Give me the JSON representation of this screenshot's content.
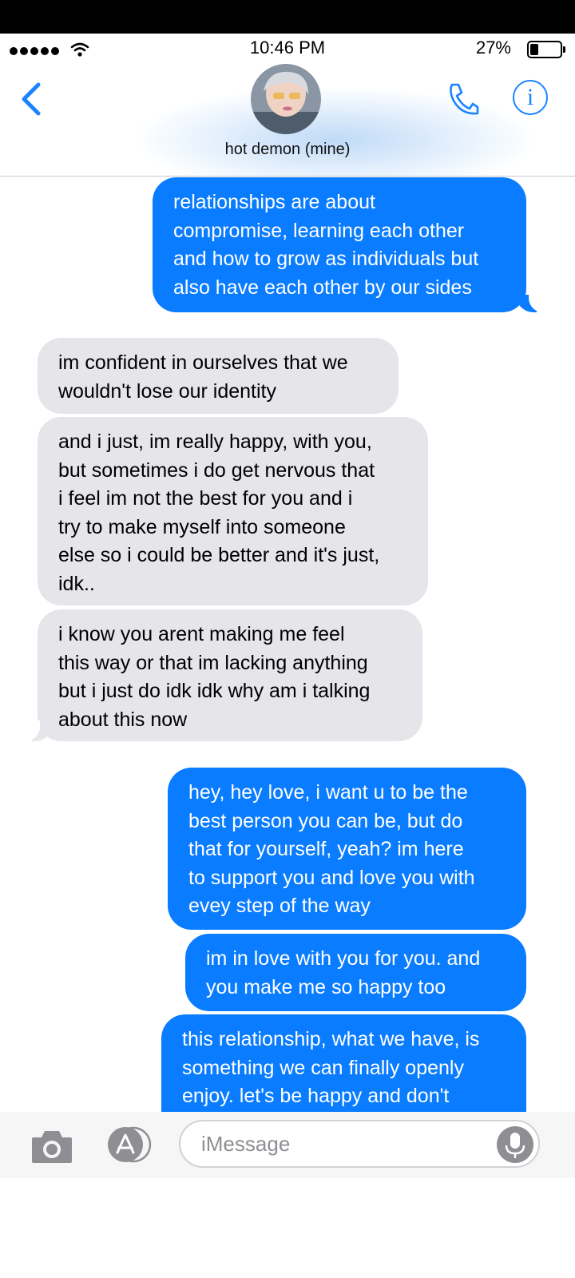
{
  "status_bar": {
    "time": "10:46 PM",
    "battery_percent": "27%",
    "battery_level": 0.27
  },
  "header": {
    "contact_name": "hot demon (mine)"
  },
  "messages": [
    {
      "direction": "sent",
      "text": "relationships are about\ncompromise, learning each other\nand how to grow as individuals but\nalso have each other by our sides"
    },
    {
      "direction": "received",
      "text": "im confident in ourselves that we\nwouldn't lose our identity"
    },
    {
      "direction": "received",
      "text": "and i just, im really happy, with you,\nbut sometimes i do get nervous that\ni feel im not the best for you and i\ntry to make myself into someone\nelse so i could be better and it's just,\nidk.."
    },
    {
      "direction": "received",
      "text": "i know you arent making me feel\nthis way or that im lacking anything\nbut i just do idk idk why am i talking\nabout this now"
    },
    {
      "direction": "sent",
      "text": "hey, hey love, i want u to be the\nbest person you can be, but do\nthat for yourself, yeah? im here\nto support you and love you with\nevey step of the way"
    },
    {
      "direction": "sent",
      "text": "im in love with you for you. and\nyou make me so happy too"
    },
    {
      "direction": "sent",
      "text": "this relationship, what we have, is\nsomething we can finally openly\nenjoy. let's be happy and don't"
    }
  ],
  "composer": {
    "placeholder": "iMessage"
  },
  "colors": {
    "sent_bubble": "#0a7cff",
    "received_bubble": "#e5e5ea",
    "accent": "#1a84ff"
  },
  "icons": [
    "back-chevron-icon",
    "phone-icon",
    "info-icon",
    "camera-icon",
    "app-store-icon",
    "microphone-icon",
    "wifi-icon",
    "battery-icon"
  ]
}
